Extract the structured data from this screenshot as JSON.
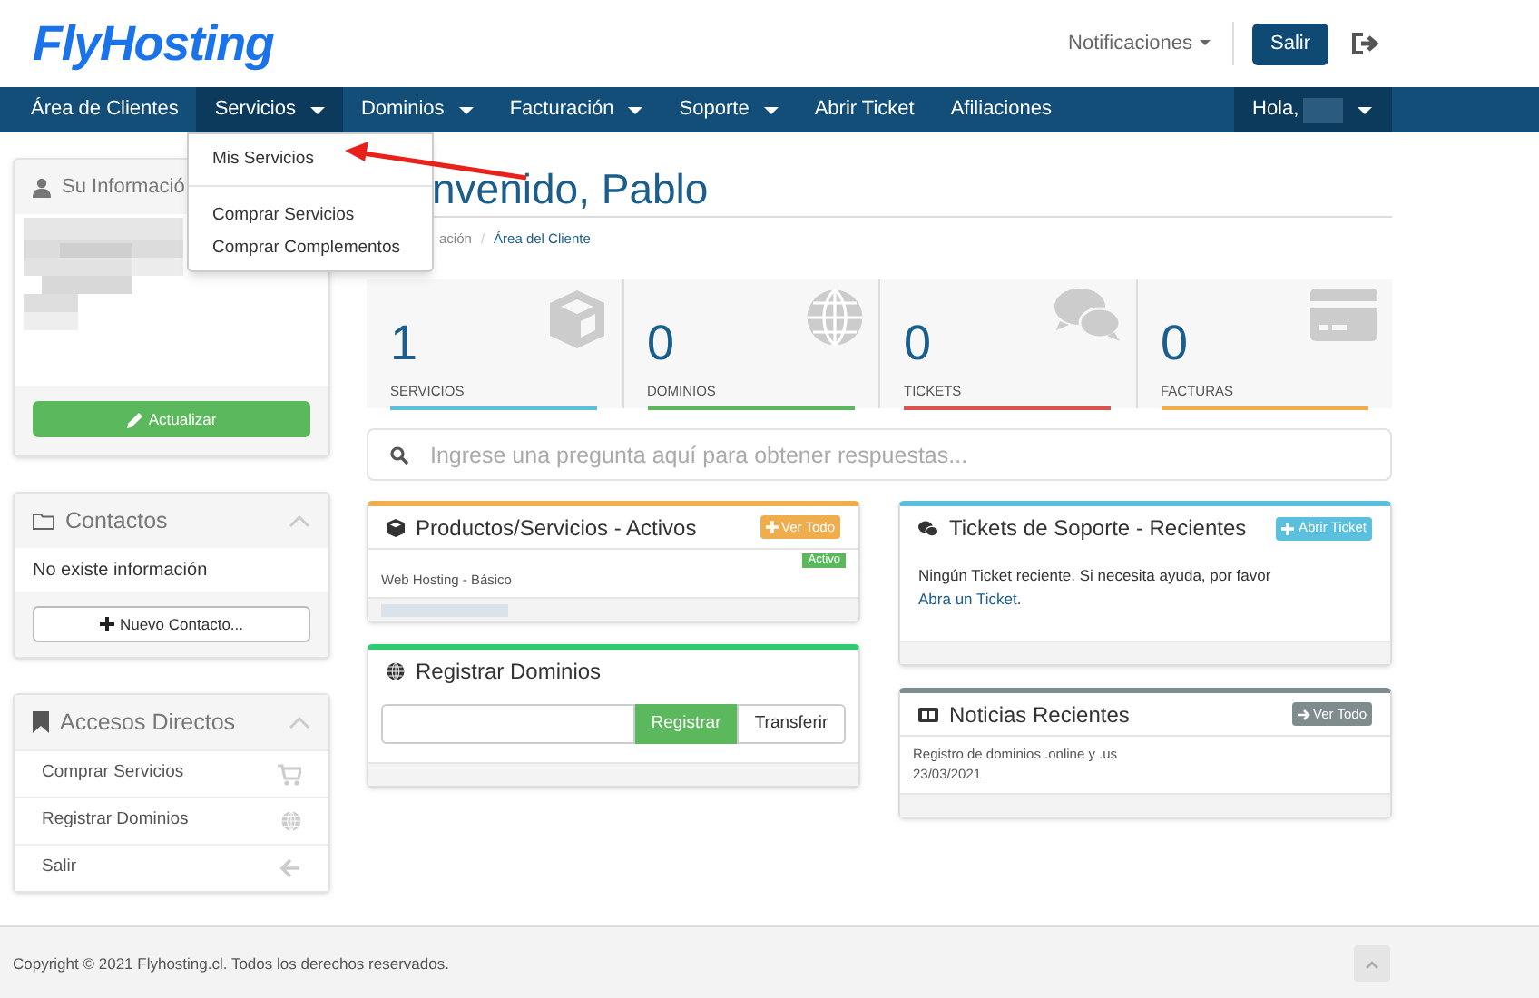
{
  "header": {
    "logo": "FlyHosting",
    "notifications": "Notificaciones",
    "logout_button": "Salir"
  },
  "nav": {
    "items": [
      {
        "label": "Área de Clientes",
        "dropdown": false,
        "selected": false
      },
      {
        "label": "Servicios",
        "dropdown": true,
        "selected": true
      },
      {
        "label": "Dominios",
        "dropdown": true,
        "selected": false
      },
      {
        "label": "Facturación",
        "dropdown": true,
        "selected": false
      },
      {
        "label": "Soporte",
        "dropdown": true,
        "selected": false
      },
      {
        "label": "Abrir Ticket",
        "dropdown": false,
        "selected": false
      },
      {
        "label": "Afiliaciones",
        "dropdown": false,
        "selected": false
      }
    ],
    "greeting": "Hola,",
    "menu": [
      [
        "Mis Servicios"
      ],
      [
        "Comprar Servicios",
        "Comprar Complementos"
      ]
    ]
  },
  "sidebar": {
    "info": {
      "title": "Su Informació",
      "button": "Actualizar"
    },
    "contacts": {
      "title": "Contactos",
      "empty": "No existe información",
      "button": "Nuevo Contacto..."
    },
    "shortcuts": {
      "title": "Accesos Directos",
      "items": [
        "Comprar Servicios",
        "Registrar Dominios",
        "Salir"
      ]
    }
  },
  "main": {
    "title": "nvenido, Pablo",
    "breadcrumb": [
      "ación",
      "Área del Cliente"
    ],
    "breadcrumb_separator": "/",
    "stats": [
      {
        "value": "1",
        "label": "SERVICIOS",
        "color": "#5bc0de"
      },
      {
        "value": "0",
        "label": "DOMINIOS",
        "color": "#5cb85c"
      },
      {
        "value": "0",
        "label": "TICKETS",
        "color": "#d9534f"
      },
      {
        "value": "0",
        "label": "FACTURAS",
        "color": "#f0ad4e"
      }
    ],
    "search": {
      "placeholder": "Ingrese una pregunta aquí para obtener respuestas..."
    },
    "products": {
      "title": "Productos/Servicios - Activos",
      "button": "Ver Todo",
      "rows": [
        {
          "name": "Web Hosting - Básico",
          "status": "Activo"
        }
      ]
    },
    "domains": {
      "title": "Registrar Dominios",
      "buttons": [
        "Registrar",
        "Transferir"
      ]
    },
    "tickets": {
      "title": "Tickets de Soporte - Recientes",
      "button": "Abrir Ticket",
      "message": "Ningún Ticket reciente. Si necesita ayuda, por favor",
      "link": "Abra un Ticket",
      "end": "."
    },
    "news": {
      "title": "Noticias Recientes",
      "button": "Ver Todo",
      "items": [
        {
          "title": "Registro de dominios .online y .us",
          "date": "23/03/2021"
        }
      ]
    }
  },
  "footer": {
    "copyright": "Copyright © 2021 Flyhosting.cl. Todos los derechos reservados."
  }
}
